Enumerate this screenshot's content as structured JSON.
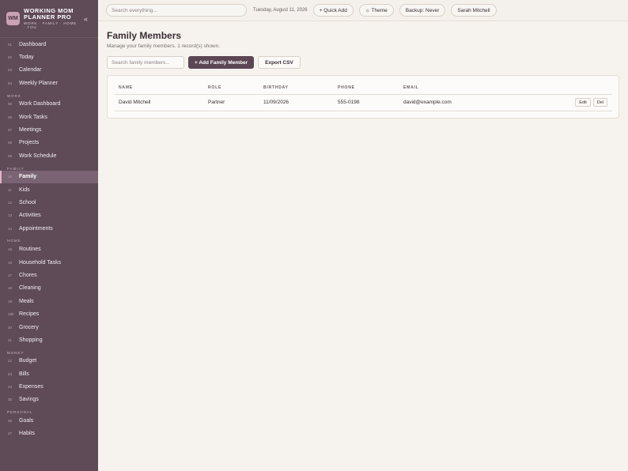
{
  "brand": {
    "logo": "WM",
    "title": "WORKING MOM PLANNER PRO",
    "subtitle": "WORK · FAMILY · HOME · YOU",
    "collapse_icon": "«"
  },
  "sidebar": {
    "items_top": [
      {
        "num": "01",
        "label": "Dashboard"
      },
      {
        "num": "02",
        "label": "Today"
      },
      {
        "num": "03",
        "label": "Calendar"
      },
      {
        "num": "04",
        "label": "Weekly Planner"
      }
    ],
    "sections": [
      {
        "label": "WORK",
        "items": [
          {
            "num": "05",
            "label": "Work Dashboard"
          },
          {
            "num": "06",
            "label": "Work Tasks"
          },
          {
            "num": "07",
            "label": "Meetings"
          },
          {
            "num": "08",
            "label": "Projects"
          },
          {
            "num": "09",
            "label": "Work Schedule"
          }
        ]
      },
      {
        "label": "FAMILY",
        "items": [
          {
            "num": "10",
            "label": "Family",
            "active": true
          },
          {
            "num": "11",
            "label": "Kids"
          },
          {
            "num": "12",
            "label": "School"
          },
          {
            "num": "13",
            "label": "Activities"
          },
          {
            "num": "14",
            "label": "Appointments"
          }
        ]
      },
      {
        "label": "HOME",
        "items": [
          {
            "num": "15",
            "label": "Routines"
          },
          {
            "num": "16",
            "label": "Household Tasks"
          },
          {
            "num": "17",
            "label": "Chores"
          },
          {
            "num": "18",
            "label": "Cleaning"
          },
          {
            "num": "19",
            "label": "Meals"
          },
          {
            "num": "19b",
            "label": "Recipes"
          },
          {
            "num": "20",
            "label": "Grocery"
          },
          {
            "num": "21",
            "label": "Shopping"
          }
        ]
      },
      {
        "label": "MONEY",
        "items": [
          {
            "num": "22",
            "label": "Budget"
          },
          {
            "num": "23",
            "label": "Bills"
          },
          {
            "num": "24",
            "label": "Expenses"
          },
          {
            "num": "25",
            "label": "Savings"
          }
        ]
      },
      {
        "label": "PERSONAL",
        "items": [
          {
            "num": "26",
            "label": "Goals"
          },
          {
            "num": "27",
            "label": "Habits"
          }
        ]
      }
    ]
  },
  "topbar": {
    "search_placeholder": "Search everything...",
    "date": "Tuesday, August 11, 2026",
    "quick_add": "+ Quick Add",
    "theme": "☼ Theme",
    "backup": "Backup: Never",
    "user": "Sarah Mitchell"
  },
  "main": {
    "title": "Family Members",
    "subtitle": "Manage your family members. 1 record(s) shown.",
    "search_placeholder": "Search family members...",
    "add_button": "+ Add Family Member",
    "export_button": "Export CSV"
  },
  "table": {
    "columns": [
      "NAME",
      "ROLE",
      "BIRTHDAY",
      "PHONE",
      "EMAIL"
    ],
    "rows": [
      {
        "name": "David Mitchell",
        "role": "Partner",
        "birthday": "11/09/2026",
        "phone": "555-0198",
        "email": "david@example.com",
        "edit": "Edit",
        "del": "Del"
      }
    ]
  },
  "colors": {
    "sidebar": "#5f4a58",
    "accent": "#5b4654",
    "active": "#7a6372",
    "background": "#f6f3ef"
  }
}
